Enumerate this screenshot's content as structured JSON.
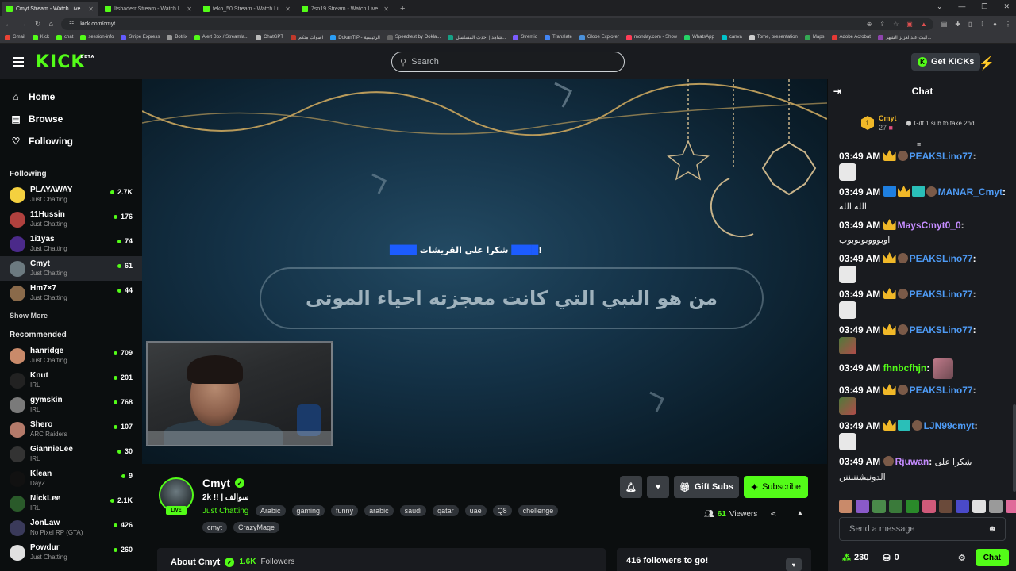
{
  "browser": {
    "tabs": [
      {
        "label": "Cmyt Stream - Watch Live on Kick",
        "active": true
      },
      {
        "label": "Itsbaderr Stream - Watch Live on Kick",
        "active": false
      },
      {
        "label": "teko_50 Stream - Watch Live on Kick",
        "active": false
      },
      {
        "label": "7so19 Stream - Watch Live on Kick",
        "active": false
      }
    ],
    "url": "kick.com/cmyt",
    "bookmarks": [
      "Gmail",
      "Kick",
      "chat",
      "session-info",
      "Stripe Express",
      "Botrix",
      "Alert Box / Streamla...",
      "ChatGPT",
      "اصوات متكم",
      "DokanTIP - الرئيسية",
      "Speedtest by Ookla...",
      "شاهد | أحدث المسلسل...",
      "Stremio",
      "Translate",
      "Globe Explorer",
      "monday.com - Show",
      "WhatsApp",
      "canva",
      "Tome, presentation",
      "Maps",
      "Adobe Acrobat",
      "البث عبدالعزيز الشهر..."
    ]
  },
  "header": {
    "logo": "KICK",
    "logo_sup": "BETA",
    "search_placeholder": "Search",
    "get_kicks": "Get KICKs"
  },
  "sidebar": {
    "nav": [
      {
        "label": "Home",
        "icon": "home-icon"
      },
      {
        "label": "Browse",
        "icon": "browse-icon"
      },
      {
        "label": "Following",
        "icon": "heart-icon"
      }
    ],
    "following_title": "Following",
    "following": [
      {
        "name": "PLAYAWAY",
        "category": "Just Chatting",
        "viewers": "2.7K",
        "color": "#f4d03f"
      },
      {
        "name": "11Hussin",
        "category": "Just Chatting",
        "viewers": "176",
        "color": "#b0413e"
      },
      {
        "name": "1i1yas",
        "category": "Just Chatting",
        "viewers": "74",
        "color": "#4b2a8a"
      },
      {
        "name": "Cmyt",
        "category": "Just Chatting",
        "viewers": "61",
        "color": "#6c7a80"
      },
      {
        "name": "Hm7×7",
        "category": "Just Chatting",
        "viewers": "44",
        "color": "#8a6a4a"
      }
    ],
    "show_more": "Show More",
    "recommended_title": "Recommended",
    "recommended": [
      {
        "name": "hanridge",
        "category": "Just Chatting",
        "viewers": "709",
        "color": "#c98a6a"
      },
      {
        "name": "Knut",
        "category": "IRL",
        "viewers": "201",
        "color": "#222222"
      },
      {
        "name": "gymskin",
        "category": "IRL",
        "viewers": "768",
        "color": "#7a7a7a"
      },
      {
        "name": "Shero",
        "category": "ARC Raiders",
        "viewers": "107",
        "color": "#b47a6a"
      },
      {
        "name": "GiannieLee",
        "category": "IRL",
        "viewers": "30",
        "color": "#333333"
      },
      {
        "name": "Klean",
        "category": "DayZ",
        "viewers": "9",
        "color": "#111111"
      },
      {
        "name": "NickLee",
        "category": "IRL",
        "viewers": "2.1K",
        "color": "#2a5a2a"
      },
      {
        "name": "JonLaw",
        "category": "No Pixel RP (GTA)",
        "viewers": "426",
        "color": "#3a3a5a"
      },
      {
        "name": "Powdur",
        "category": "Just Chatting",
        "viewers": "260",
        "color": "#e0e0e0"
      }
    ]
  },
  "video": {
    "overlay_thanks_pre": "!",
    "overlay_thanks_mid": "شكرا على القريشات",
    "question": "من هو النبي التي كانت معجزته احياء الموتى"
  },
  "channel": {
    "name": "Cmyt",
    "live_label": "LIVE",
    "title": "2k !! | سوالف",
    "category": "Just Chatting",
    "tags": [
      "Arabic",
      "gaming",
      "funny",
      "arabic",
      "saudi",
      "qatar",
      "uae",
      "Q8",
      "chellenge",
      "cmyt",
      "CrazyMage"
    ],
    "gift_subs": "Gift Subs",
    "subscribe": "Subscribe",
    "viewers": "61",
    "viewers_label": "Viewers",
    "about_label": "About Cmyt",
    "followers_count": "1.6K",
    "followers_label": "Followers",
    "goal": "416 followers to go!"
  },
  "chat": {
    "title": "Chat",
    "pinned": {
      "rank": "1",
      "user": "Cmyt",
      "count": "27",
      "gift_text": "Gift 1 sub to take 2nd"
    },
    "messages": [
      {
        "time": "03:49 AM",
        "user": "PEAKSLino77",
        "color": "blue",
        "badges": [
          "gold",
          "face"
        ],
        "emote": "white",
        "text": ""
      },
      {
        "time": "03:49 AM",
        "user": "MANAR_Cmyt",
        "color": "blue",
        "badges": [
          "blue",
          "gold",
          "teal",
          "face"
        ],
        "emote": "",
        "text": "الله الله"
      },
      {
        "time": "03:49 AM",
        "user": "MaysCmyt0_0",
        "color": "purple",
        "badges": [
          "gold"
        ],
        "emote": "",
        "text": "اوبوووبوبوبوب"
      },
      {
        "time": "03:49 AM",
        "user": "PEAKSLino77",
        "color": "blue",
        "badges": [
          "gold",
          "face"
        ],
        "emote": "white",
        "text": ""
      },
      {
        "time": "03:49 AM",
        "user": "PEAKSLino77",
        "color": "blue",
        "badges": [
          "gold",
          "face"
        ],
        "emote": "white",
        "text": ""
      },
      {
        "time": "03:49 AM",
        "user": "PEAKSLino77",
        "color": "blue",
        "badges": [
          "gold",
          "face"
        ],
        "emote": "pic",
        "text": ""
      },
      {
        "time": "03:49 AM",
        "user": "fhnbcfhjn",
        "color": "green",
        "badges": [],
        "emote": "pink",
        "text": ""
      },
      {
        "time": "03:49 AM",
        "user": "PEAKSLino77",
        "color": "blue",
        "badges": [
          "gold",
          "face"
        ],
        "emote": "pic",
        "text": ""
      },
      {
        "time": "03:49 AM",
        "user": "LJN99cmyt",
        "color": "blue",
        "badges": [
          "gold",
          "teal",
          "face"
        ],
        "emote": "white",
        "text": ""
      },
      {
        "time": "03:49 AM",
        "user": "Rjuwan",
        "color": "purple",
        "badges": [
          "face"
        ],
        "emote": "",
        "text": "شكرا على الدونيشنننننن"
      }
    ],
    "send_placeholder": "Send a message",
    "points": "230",
    "subs_count": "0",
    "chat_button": "Chat"
  }
}
